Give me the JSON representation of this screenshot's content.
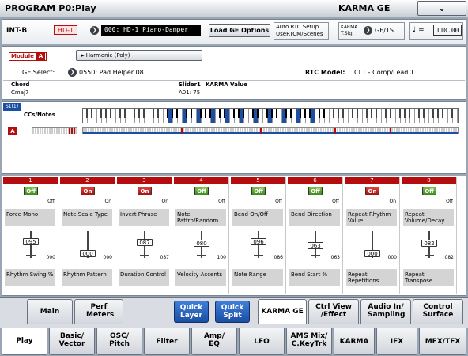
{
  "title": "PROGRAM P0:Play",
  "mode": "KARMA GE",
  "program": {
    "bank": "INT-B",
    "bank_code": "HD-1",
    "name": "000: HD-1 Piano-Damper"
  },
  "load_ge_label": "Load GE Options",
  "rtc_setup": "Auto RTC Setup",
  "rtc_setup_sub": "UseRTCM/Scenes",
  "karma_tsig_line1": "KARMA",
  "karma_tsig_line2": "T.Sig:",
  "tsig_value": "GE/TS",
  "tempo_symbol": "♩ =",
  "tempo": "110.00",
  "module_label": "Module",
  "module_letter": "A",
  "harmonic": "Harmonic (Poly)",
  "ge_select_label": "GE Select:",
  "ge_select_value": "0550: Pad Helper 08",
  "rtc_model_label": "RTC Model:",
  "rtc_model_value": "CL1 - Comp/Lead 1",
  "chord_label": "Chord",
  "chord_value": "Cmaj7",
  "slider_label": "Slider1",
  "karma_value_label": "KARMA Value",
  "slider_value": "A01: 75",
  "section_tag": "S1(1)",
  "ccs_notes": "CCs/Notes",
  "track_letter": "A",
  "columns": [
    {
      "num": "1",
      "switch": "Off",
      "state": "off",
      "state_label": "Off",
      "param": "Force Mono",
      "slider": "095",
      "slider_side": "000",
      "slider_pos": 0.75,
      "slider_param": "Rhythm Swing %"
    },
    {
      "num": "2",
      "switch": "On",
      "state": "on",
      "state_label": "On",
      "param": "Note Scale Type",
      "slider": "000",
      "slider_side": "000",
      "slider_pos": 0.0,
      "slider_param": "Rhythm Pattern"
    },
    {
      "num": "3",
      "switch": "On",
      "state": "on",
      "state_label": "On",
      "param": "Invert Phrase",
      "slider": "087",
      "slider_side": "087",
      "slider_pos": 0.68,
      "slider_param": "Duration Control"
    },
    {
      "num": "4",
      "switch": "Off",
      "state": "off",
      "state_label": "Off",
      "param": "Note Pattrn/Random",
      "slider": "080",
      "slider_side": "100",
      "slider_pos": 0.63,
      "slider_param": "Velocity Accents"
    },
    {
      "num": "5",
      "switch": "Off",
      "state": "off",
      "state_label": "Off",
      "param": "Bend On/Off",
      "slider": "096",
      "slider_side": "086",
      "slider_pos": 0.76,
      "slider_param": "Note Range"
    },
    {
      "num": "6",
      "switch": "Off",
      "state": "off",
      "state_label": "Off",
      "param": "Bend Direction",
      "slider": "063",
      "slider_side": "063",
      "slider_pos": 0.5,
      "slider_param": "Bend Start %"
    },
    {
      "num": "7",
      "switch": "On",
      "state": "on",
      "state_label": "On",
      "param": "Repeat Rhythm Value",
      "slider": "000",
      "slider_side": "000",
      "slider_pos": 0.0,
      "slider_param": "Repeat Repetitions"
    },
    {
      "num": "8",
      "switch": "Off",
      "state": "off",
      "state_label": "Off",
      "param": "Repeat Volume/Decay",
      "slider": "082",
      "slider_side": "082",
      "slider_pos": 0.65,
      "slider_param": "Repeat Transpose"
    }
  ],
  "top_tabs": [
    "Main",
    "Perf Meters",
    "Quick Layer",
    "Quick Split",
    "KARMA GE",
    "Ctrl View /Effect",
    "Audio In/ Sampling",
    "Control Surface"
  ],
  "bottom_tabs": [
    "Play",
    "Basic/ Vector",
    "OSC/ Pitch",
    "Filter",
    "Amp/ EQ",
    "LFO",
    "AMS Mix/ C.KeyTrk",
    "KARMA",
    "IFX",
    "MFX/TFX"
  ],
  "colors": {
    "accent_red": "#b50d0d",
    "switch_green": "#4f9e28",
    "quick_blue": "#2a64c0"
  }
}
